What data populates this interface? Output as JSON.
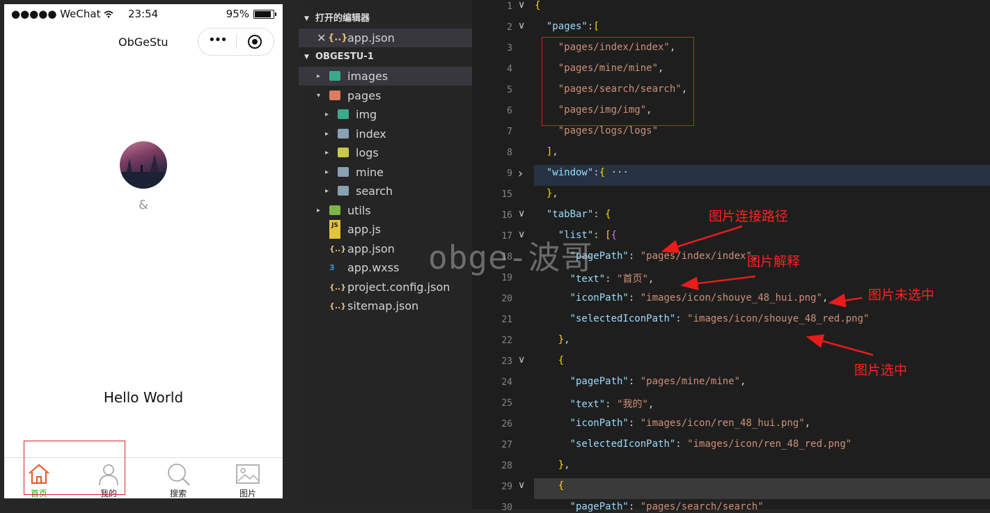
{
  "phone": {
    "status": {
      "signal": "●●●●● WeChat",
      "wifi_icon": "wifi-icon",
      "time": "23:54",
      "battery": "95%",
      "battery_level": 0.95
    },
    "nav": {
      "title": "ObGeStu",
      "menu": "•••"
    },
    "nickname": "&",
    "hello": "Hello World",
    "tabs": [
      {
        "label": "首页",
        "icon": "home-icon",
        "active": true
      },
      {
        "label": "我的",
        "icon": "user-icon",
        "active": false
      },
      {
        "label": "搜索",
        "icon": "search-icon",
        "active": false
      },
      {
        "label": "图片",
        "icon": "image-icon",
        "active": false
      }
    ],
    "active_color": "#1aad19"
  },
  "explorer": {
    "open_editors_title": "打开的编辑器",
    "open_file": "app.json",
    "project_title": "OBGESTU-1",
    "items": [
      {
        "name": "images",
        "depth": 1,
        "type": "folder",
        "arrow": "▸"
      },
      {
        "name": "pages",
        "depth": 1,
        "type": "folder",
        "arrow": "▾"
      },
      {
        "name": "img",
        "depth": 2,
        "type": "folder",
        "arrow": "▸"
      },
      {
        "name": "index",
        "depth": 2,
        "type": "folder",
        "arrow": "▸"
      },
      {
        "name": "logs",
        "depth": 2,
        "type": "folder",
        "arrow": "▸"
      },
      {
        "name": "mine",
        "depth": 2,
        "type": "folder",
        "arrow": "▸"
      },
      {
        "name": "search",
        "depth": 2,
        "type": "folder",
        "arrow": "▸"
      },
      {
        "name": "utils",
        "depth": 1,
        "type": "folder",
        "arrow": "▸"
      },
      {
        "name": "app.js",
        "depth": 1,
        "type": "js"
      },
      {
        "name": "app.json",
        "depth": 1,
        "type": "json"
      },
      {
        "name": "app.wxss",
        "depth": 1,
        "type": "css"
      },
      {
        "name": "project.config.json",
        "depth": 1,
        "type": "json"
      },
      {
        "name": "sitemap.json",
        "depth": 1,
        "type": "json"
      }
    ]
  },
  "editor": {
    "lines": [
      {
        "n": "1",
        "fold": "∨",
        "code": "{"
      },
      {
        "n": "2",
        "fold": "∨",
        "code": "  \"pages\":["
      },
      {
        "n": "3",
        "code": "    \"pages/index/index\","
      },
      {
        "n": "4",
        "code": "    \"pages/mine/mine\","
      },
      {
        "n": "5",
        "code": "    \"pages/search/search\","
      },
      {
        "n": "6",
        "code": "    \"pages/img/img\","
      },
      {
        "n": "7",
        "code": "    \"pages/logs/logs\""
      },
      {
        "n": "8",
        "code": "  ],"
      },
      {
        "n": "9",
        "fold": "›",
        "code": "  \"window\":{ ···"
      },
      {
        "n": "15",
        "code": "  },"
      },
      {
        "n": "16",
        "fold": "∨",
        "code": "  \"tabBar\": {"
      },
      {
        "n": "17",
        "fold": "∨",
        "code": "    \"list\": [{"
      },
      {
        "n": "18",
        "code": "      \"pagePath\": \"pages/index/index\","
      },
      {
        "n": "19",
        "code": "      \"text\": \"首页\","
      },
      {
        "n": "20",
        "code": "      \"iconPath\": \"images/icon/shouye_48_hui.png\","
      },
      {
        "n": "21",
        "code": "      \"selectedIconPath\": \"images/icon/shouye_48_red.png\""
      },
      {
        "n": "22",
        "code": "    },"
      },
      {
        "n": "23",
        "fold": "∨",
        "code": "    {"
      },
      {
        "n": "24",
        "code": "      \"pagePath\": \"pages/mine/mine\","
      },
      {
        "n": "25",
        "code": "      \"text\": \"我的\","
      },
      {
        "n": "26",
        "code": "      \"iconPath\": \"images/icon/ren_48_hui.png\","
      },
      {
        "n": "27",
        "code": "      \"selectedIconPath\": \"images/icon/ren_48_red.png\""
      },
      {
        "n": "28",
        "code": "    },"
      },
      {
        "n": "29",
        "fold": "∨",
        "code": "    {"
      },
      {
        "n": "30",
        "code": "      \"pagePath\": \"pages/search/search\""
      }
    ]
  },
  "annotations": {
    "link_path": "图片连接路径",
    "explain": "图片解释",
    "unselected": "图片未选中",
    "selected": "图片选中"
  },
  "watermark": "obge-波哥",
  "colors": {
    "annotation": "#e02020",
    "string": "#ce9178",
    "key": "#9cdcfe"
  }
}
